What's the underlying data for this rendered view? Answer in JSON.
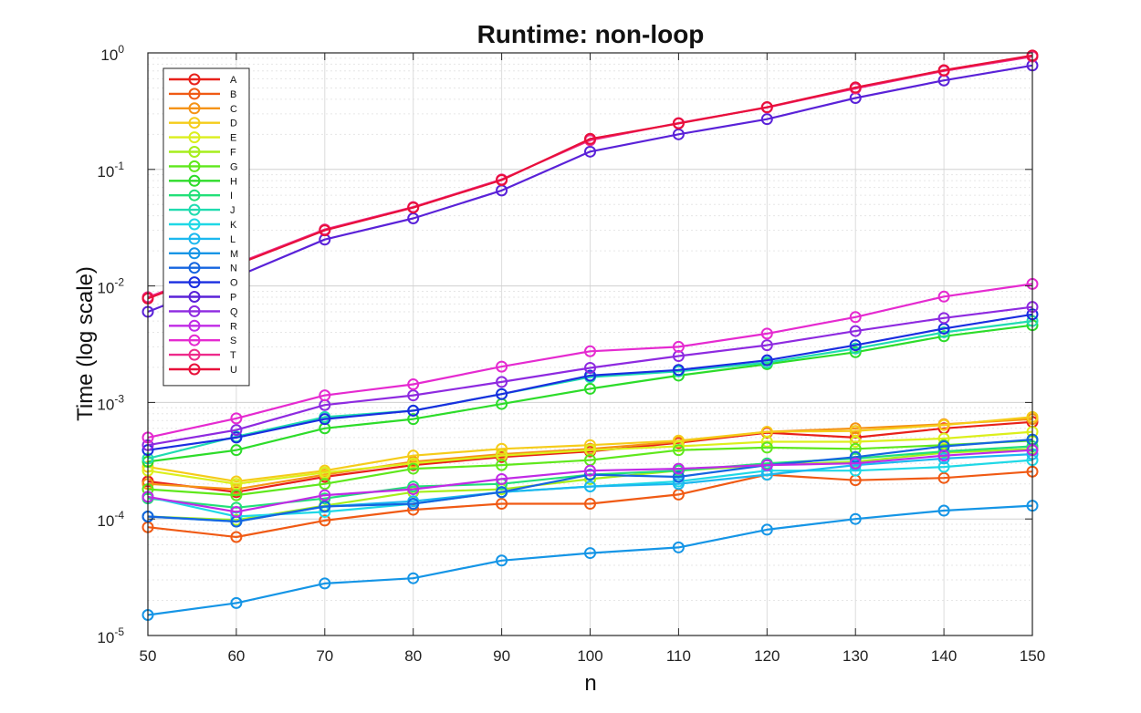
{
  "chart_data": {
    "type": "line",
    "title": "Runtime: non-loop",
    "xlabel": "n",
    "ylabel": "Time (log scale)",
    "yscale": "log",
    "xlim": [
      50,
      150
    ],
    "ylim": [
      1e-05,
      1
    ],
    "xticks": [
      50,
      60,
      70,
      80,
      90,
      100,
      110,
      120,
      130,
      140,
      150
    ],
    "ytick_labels": [
      {
        "base": "10",
        "exp": "-5"
      },
      {
        "base": "10",
        "exp": "-4"
      },
      {
        "base": "10",
        "exp": "-3"
      },
      {
        "base": "10",
        "exp": "-2"
      },
      {
        "base": "10",
        "exp": "-1"
      },
      {
        "base": "10",
        "exp": "0"
      }
    ],
    "grid": true,
    "minor_grid": true,
    "legend_position": "top-left",
    "marker": "circle",
    "x": [
      50,
      60,
      70,
      80,
      90,
      100,
      110,
      120,
      130,
      140,
      150
    ],
    "series": [
      {
        "name": "A",
        "color": "#e8211a",
        "values": [
          0.00021,
          0.00017,
          0.00023,
          0.00029,
          0.00034,
          0.00038,
          0.00045,
          0.00055,
          0.0005,
          0.0006,
          0.00068
        ]
      },
      {
        "name": "B",
        "color": "#f05a14",
        "values": [
          8.5e-05,
          7e-05,
          9.7e-05,
          0.00012,
          0.000135,
          0.000135,
          0.000162,
          0.00024,
          0.000215,
          0.000225,
          0.000255
        ]
      },
      {
        "name": "C",
        "color": "#f59316",
        "values": [
          0.0002,
          0.00018,
          0.00024,
          0.00031,
          0.00036,
          0.0004,
          0.00046,
          0.00056,
          0.0006,
          0.00065,
          0.00072
        ]
      },
      {
        "name": "D",
        "color": "#f5cc1a",
        "values": [
          0.00028,
          0.00021,
          0.00026,
          0.00035,
          0.0004,
          0.00043,
          0.00047,
          0.00056,
          0.00057,
          0.00064,
          0.00075
        ]
      },
      {
        "name": "E",
        "color": "#dcef1c",
        "values": [
          0.00026,
          0.0002,
          0.00025,
          0.0003,
          0.00035,
          0.00039,
          0.00042,
          0.00046,
          0.00046,
          0.00049,
          0.00056
        ]
      },
      {
        "name": "F",
        "color": "#a6ee1c",
        "values": [
          0.000105,
          9.8e-05,
          0.00013,
          0.00017,
          0.00018,
          0.00022,
          0.00026,
          0.00029,
          0.00031,
          0.00037,
          0.0004
        ]
      },
      {
        "name": "G",
        "color": "#5fe81c",
        "values": [
          0.00018,
          0.00016,
          0.0002,
          0.00027,
          0.00029,
          0.00032,
          0.00039,
          0.00041,
          0.0004,
          0.00043,
          0.00047
        ]
      },
      {
        "name": "H",
        "color": "#2ddc2a",
        "values": [
          0.00031,
          0.00039,
          0.0006,
          0.00072,
          0.00097,
          0.00131,
          0.0017,
          0.00213,
          0.0027,
          0.0037,
          0.0046
        ]
      },
      {
        "name": "I",
        "color": "#22e078",
        "values": [
          0.00015,
          0.000125,
          0.00015,
          0.00019,
          0.0002,
          0.00024,
          0.00026,
          0.0003,
          0.00033,
          0.00038,
          0.00042
        ]
      },
      {
        "name": "J",
        "color": "#20dcb0",
        "values": [
          0.00033,
          0.00051,
          0.00075,
          0.00085,
          0.00118,
          0.00165,
          0.00185,
          0.0022,
          0.0029,
          0.004,
          0.005
        ]
      },
      {
        "name": "K",
        "color": "#1fd8e6",
        "values": [
          0.000155,
          0.000105,
          0.000115,
          0.000135,
          0.00017,
          0.00019,
          0.00021,
          0.00026,
          0.00026,
          0.00028,
          0.00032
        ]
      },
      {
        "name": "L",
        "color": "#1cb8ef",
        "values": [
          0.000105,
          9.5e-05,
          0.000128,
          0.000142,
          0.00017,
          0.00019,
          0.0002,
          0.00024,
          0.00029,
          0.00033,
          0.00036
        ]
      },
      {
        "name": "M",
        "color": "#1595e6",
        "values": [
          1.5e-05,
          1.9e-05,
          2.8e-05,
          3.1e-05,
          4.4e-05,
          5.1e-05,
          5.7e-05,
          8.1e-05,
          0.0001,
          0.000118,
          0.00013
        ]
      },
      {
        "name": "N",
        "color": "#1565e0",
        "values": [
          0.000105,
          9.5e-05,
          0.000128,
          0.000135,
          0.00017,
          0.00024,
          0.00023,
          0.00029,
          0.00034,
          0.00042,
          0.00048
        ]
      },
      {
        "name": "O",
        "color": "#1a2ee0",
        "values": [
          0.00039,
          0.0005,
          0.00072,
          0.00085,
          0.00118,
          0.0017,
          0.0019,
          0.0023,
          0.0031,
          0.0043,
          0.0057
        ]
      },
      {
        "name": "P",
        "color": "#5a22d8",
        "values": [
          0.006,
          0.012,
          0.025,
          0.038,
          0.066,
          0.142,
          0.2,
          0.27,
          0.41,
          0.58,
          0.78
        ]
      },
      {
        "name": "Q",
        "color": "#8e2ae0",
        "values": [
          0.00043,
          0.00058,
          0.00095,
          0.00115,
          0.0015,
          0.00198,
          0.0025,
          0.0031,
          0.0041,
          0.0053,
          0.0066
        ]
      },
      {
        "name": "R",
        "color": "#c02ae6",
        "values": [
          0.000155,
          0.000115,
          0.00016,
          0.00018,
          0.00022,
          0.00026,
          0.00027,
          0.00029,
          0.0003,
          0.00035,
          0.00039
        ]
      },
      {
        "name": "S",
        "color": "#e52ad0",
        "values": [
          0.0005,
          0.00073,
          0.00115,
          0.00143,
          0.00203,
          0.00275,
          0.003,
          0.0039,
          0.0054,
          0.0081,
          0.0104
        ]
      },
      {
        "name": "T",
        "color": "#ee2a8a",
        "values": [
          0.008,
          0.0155,
          0.0305,
          0.0475,
          0.082,
          0.178,
          0.25,
          0.34,
          0.495,
          0.7,
          0.93
        ]
      },
      {
        "name": "U",
        "color": "#e8103a",
        "values": [
          0.0078,
          0.0152,
          0.03,
          0.047,
          0.081,
          0.183,
          0.248,
          0.342,
          0.505,
          0.71,
          0.95
        ]
      }
    ]
  }
}
